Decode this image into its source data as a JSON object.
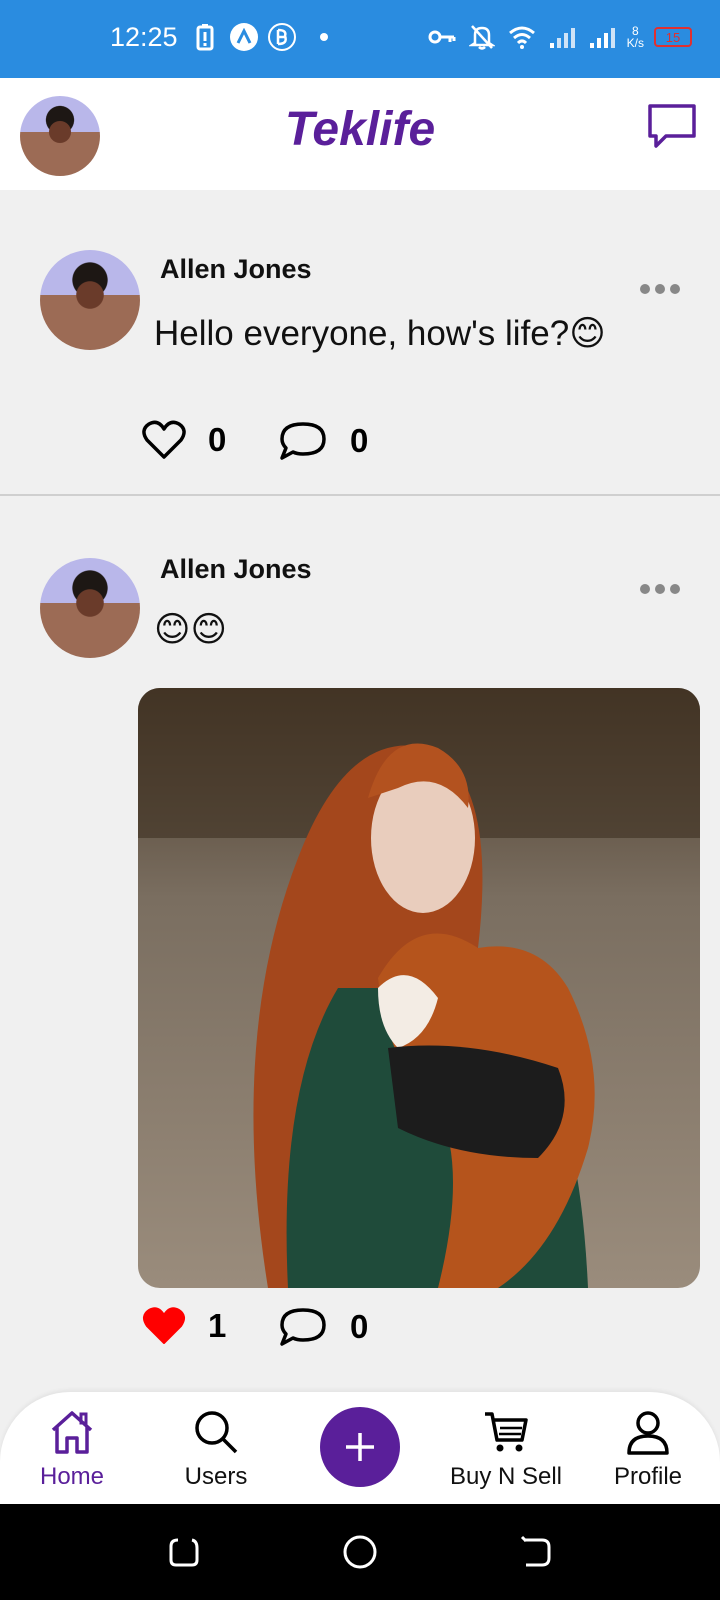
{
  "status_bar": {
    "time": "12:25",
    "speed_value": "8",
    "speed_unit": "K/s",
    "battery": "15"
  },
  "header": {
    "title": "Teklife"
  },
  "posts": [
    {
      "author": "Allen Jones",
      "text": "Hello everyone, how's life?😊",
      "likes": "0",
      "comments": "0",
      "liked": false
    },
    {
      "author": "Allen Jones",
      "text": "😊😊",
      "likes": "1",
      "comments": "0",
      "liked": true
    }
  ],
  "bottom_nav": {
    "items": [
      {
        "label": "Home",
        "icon": "home-icon",
        "active": true
      },
      {
        "label": "Users",
        "icon": "search-icon",
        "active": false
      },
      {
        "label": "Buy N Sell",
        "icon": "cart-icon",
        "active": false
      },
      {
        "label": "Profile",
        "icon": "person-icon",
        "active": false
      }
    ],
    "fab_icon": "plus-icon"
  },
  "colors": {
    "status_bar": "#2a8ce0",
    "brand": "#5a1f9a",
    "like_active": "#ff0000",
    "background": "#f0f0f0"
  }
}
